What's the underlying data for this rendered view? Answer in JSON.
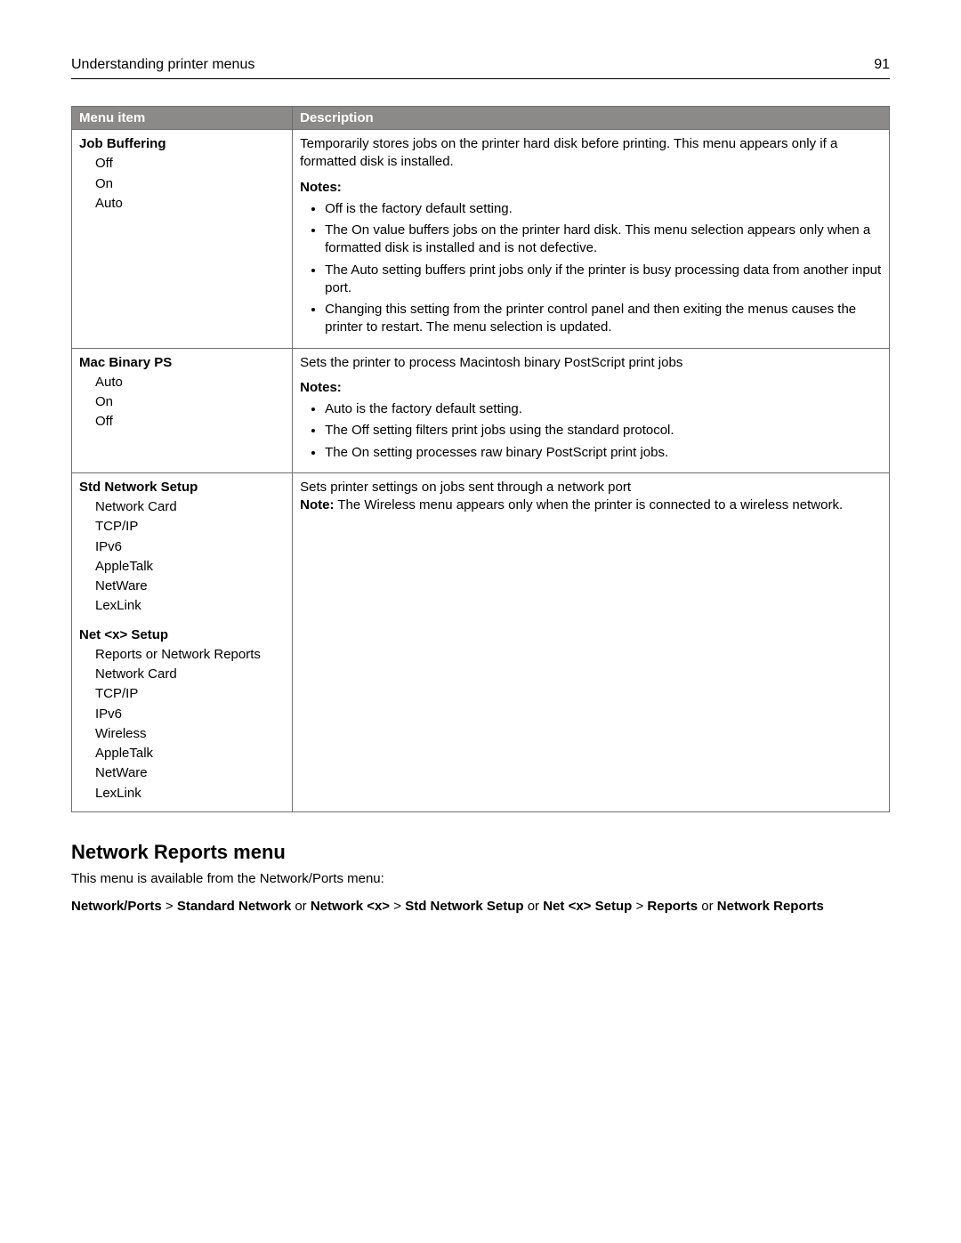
{
  "page": {
    "running_title": "Understanding printer menus",
    "number": "91"
  },
  "table": {
    "headers": {
      "menu_item": "Menu item",
      "description": "Description"
    },
    "rows": [
      {
        "title": "Job Buffering",
        "options": [
          "Off",
          "On",
          "Auto"
        ],
        "desc_intro": "Temporarily stores jobs on the printer hard disk before printing. This menu appears only if a formatted disk is installed.",
        "notes_label": "Notes:",
        "notes": [
          "Off is the factory default setting.",
          "The On value buffers jobs on the printer hard disk. This menu selection appears only when a formatted disk is installed and is not defective.",
          "The Auto setting buffers print jobs only if the printer is busy processing data from another input port.",
          "Changing this setting from the printer control panel and then exiting the menus causes the printer to restart. The menu selection is updated."
        ]
      },
      {
        "title": "Mac Binary PS",
        "options": [
          "Auto",
          "On",
          "Off"
        ],
        "desc_intro": "Sets the printer to process Macintosh binary PostScript print jobs",
        "notes_label": "Notes:",
        "notes": [
          "Auto is the factory default setting.",
          "The Off setting filters print jobs using the standard protocol.",
          "The On setting processes raw binary PostScript print jobs."
        ]
      },
      {
        "title": "Std Network Setup",
        "options": [
          "Network Card",
          "TCP/IP",
          "IPv6",
          "AppleTalk",
          "NetWare",
          "LexLink"
        ],
        "title2": "Net <x> Setup",
        "options2": [
          "Reports or Network Reports",
          "Network Card",
          "TCP/IP",
          "IPv6",
          "Wireless",
          "AppleTalk",
          "NetWare",
          "LexLink"
        ],
        "desc_intro": "Sets printer settings on jobs sent through a network port",
        "note_inline_label": "Note:",
        "note_inline": " The Wireless menu appears only when the printer is connected to a wireless network."
      }
    ]
  },
  "section": {
    "heading": "Network Reports menu",
    "intro": "This menu is available from the Network/Ports menu:",
    "crumb": {
      "p1": "Network/Ports",
      "sep1": " > ",
      "p2": "Standard Network",
      "or1": " or ",
      "p3": "Network <x>",
      "sep2": " > ",
      "p4": "Std Network Setup",
      "or2": " or ",
      "p5": "Net <x> Setup",
      "sep3": " > ",
      "p6": "Reports",
      "or3": " or ",
      "p7": "Network Reports"
    }
  }
}
